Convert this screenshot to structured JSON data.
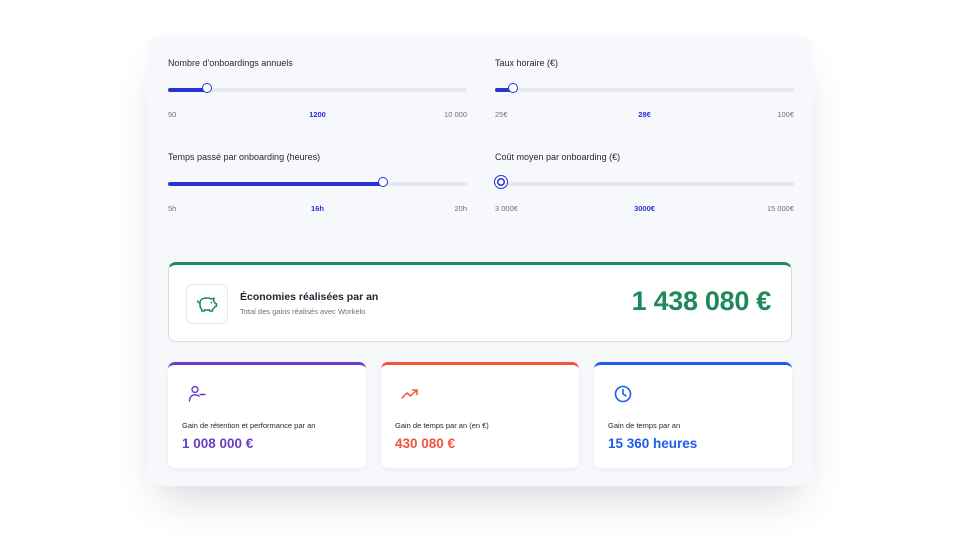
{
  "sliders": [
    {
      "label": "Nombre d'onboardings annuels",
      "min_label": "50",
      "current_label": "1200",
      "max_label": "10 000",
      "fraction": 0.13,
      "ring": false
    },
    {
      "label": "Taux horaire (€)",
      "min_label": "25€",
      "current_label": "28€",
      "max_label": "100€",
      "fraction": 0.06,
      "ring": false
    },
    {
      "label": "Temps passé par onboarding (heures)",
      "min_label": "5h",
      "current_label": "16h",
      "max_label": "20h",
      "fraction": 0.72,
      "ring": false
    },
    {
      "label": "Coût moyen par onboarding (€)",
      "min_label": "3 000€",
      "current_label": "3000€",
      "max_label": "15 000€",
      "fraction": 0.02,
      "ring": true
    }
  ],
  "savings": {
    "icon": "piggy-bank-icon",
    "title": "Économies réalisées par an",
    "subtitle": "Total des gains réalisés avec Workelo",
    "value": "1 438 080 €",
    "color": "#1e8a5b"
  },
  "cards": [
    {
      "icon": "user-minus-icon",
      "label": "Gain de rétention et performance par an",
      "value": "1 008 000 €",
      "color": "#6a3fc6"
    },
    {
      "icon": "trending-up-icon",
      "label": "Gain de temps par an (en €)",
      "value": "430 080 €",
      "color": "#f0553a"
    },
    {
      "icon": "clock-icon",
      "label": "Gain de temps par an",
      "value": "15 360 heures",
      "color": "#1f5bea"
    }
  ],
  "colors": {
    "accent": "#2a33d6",
    "track": "#e6e8ef",
    "panel_bg": "#f7f8fb"
  }
}
